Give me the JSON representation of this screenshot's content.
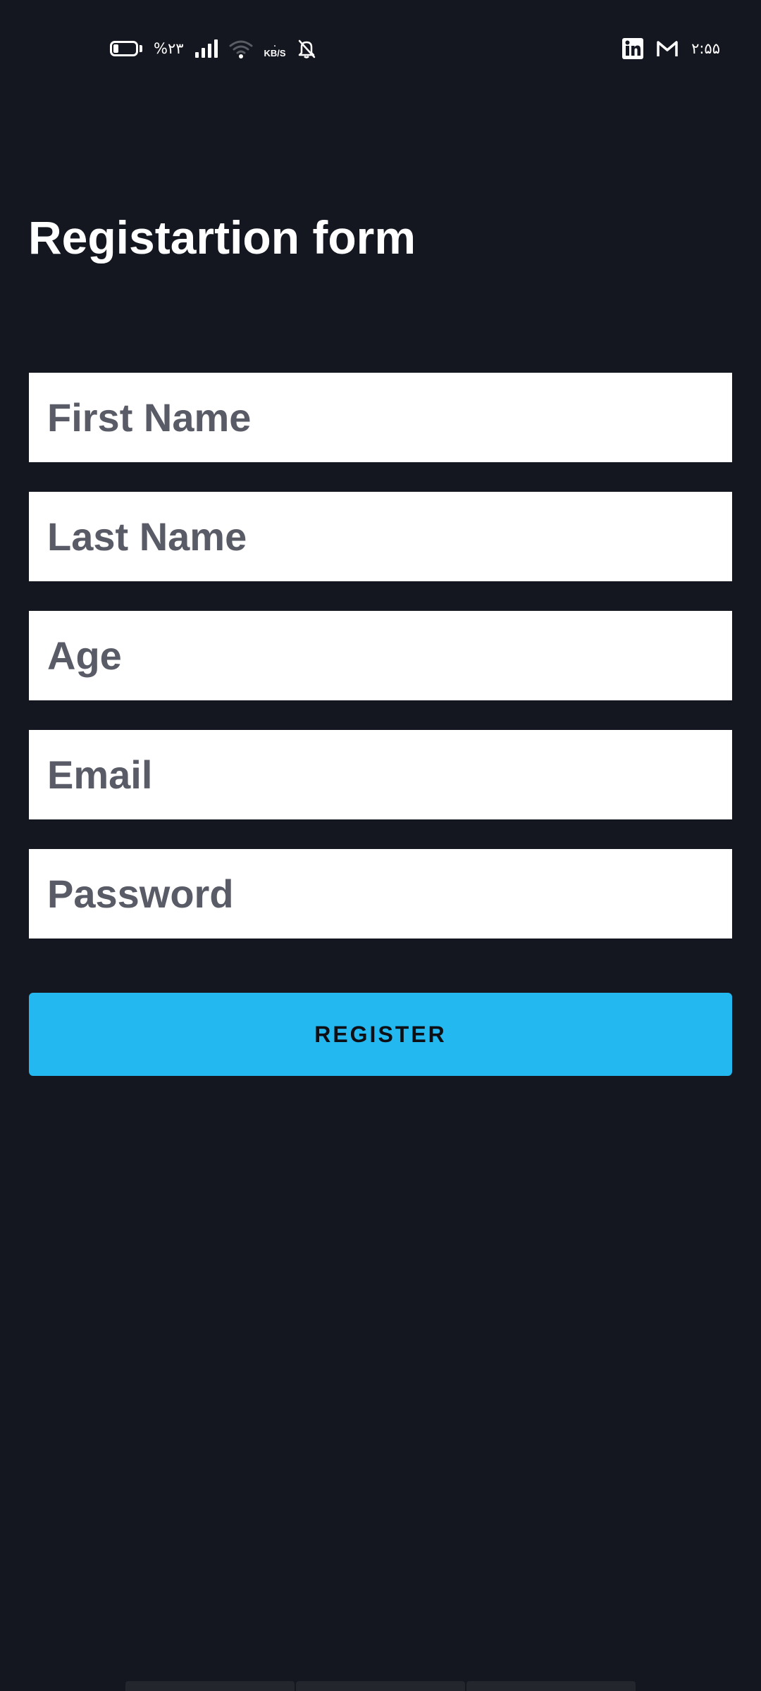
{
  "status_bar": {
    "battery_percent": "%۲۳",
    "network_speed_value": "۰",
    "network_speed_unit": "KB/S",
    "time": "۲:۵۵",
    "left_icons": [
      "battery-icon",
      "signal-icon",
      "wifi-icon",
      "network-speed",
      "bell-off-icon"
    ],
    "right_icons": [
      "linkedin-icon",
      "gmail-icon"
    ]
  },
  "form": {
    "title": "Registartion form",
    "fields": {
      "first_name": {
        "placeholder": "First Name",
        "value": ""
      },
      "last_name": {
        "placeholder": "Last Name",
        "value": ""
      },
      "age": {
        "placeholder": "Age",
        "value": ""
      },
      "email": {
        "placeholder": "Email",
        "value": ""
      },
      "password": {
        "placeholder": "Password",
        "value": ""
      }
    },
    "register_label": "REGISTER"
  },
  "colors": {
    "background": "#151720",
    "field_background": "#ffffff",
    "placeholder_text": "#595b66",
    "button_background": "#23b8ef",
    "button_text": "#0d0f14",
    "title_text": "#ffffff"
  }
}
